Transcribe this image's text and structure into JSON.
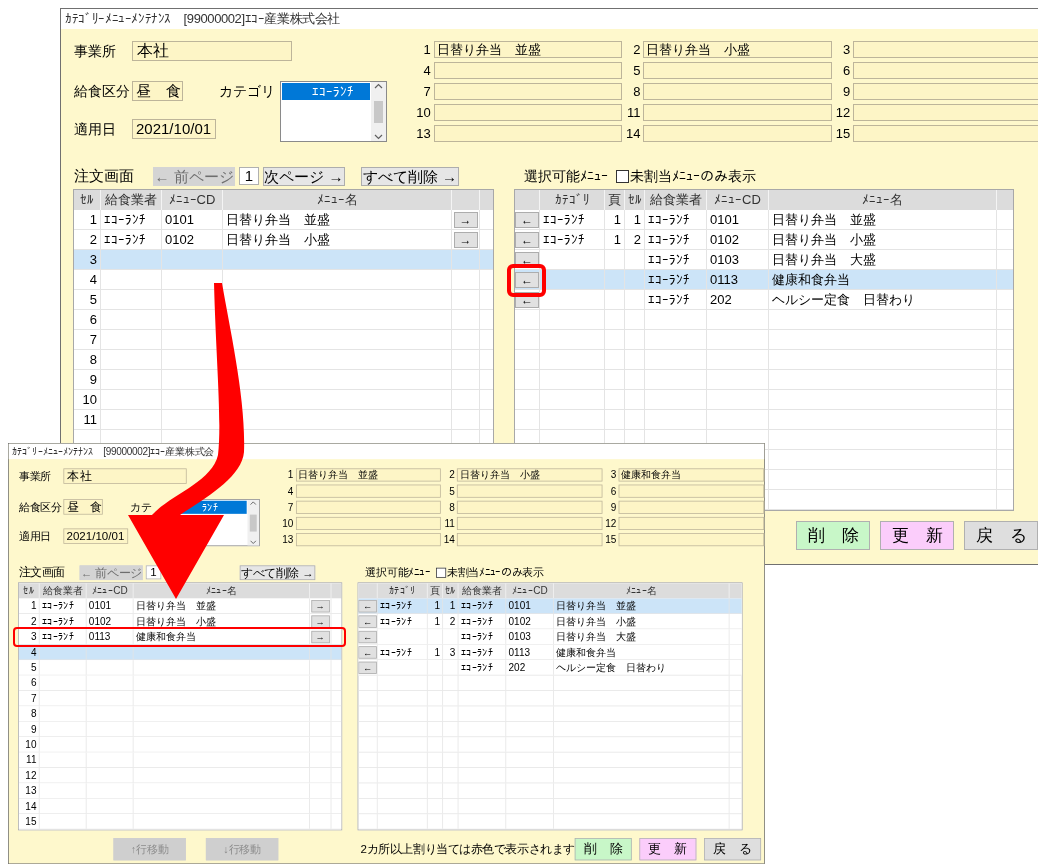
{
  "windows": [
    {
      "title": "ｶﾃｺﾞﾘｰﾒﾆｭｰﾒﾝﾃﾅﾝｽ　[99000002]ｴｺｰ産業株式会社",
      "office": {
        "label": "事業所",
        "value": "本社"
      },
      "meal": {
        "label": "給食区分",
        "value": "昼　食"
      },
      "date": {
        "label": "適用日",
        "value": "2021/10/01"
      },
      "category": {
        "label": "カテゴリ",
        "items": [
          {
            "label": "ｴｺｰﾗﾝﾁ",
            "selected": true
          }
        ]
      },
      "slots": [
        {
          "no": "1",
          "value": "日替り弁当　並盛"
        },
        {
          "no": "2",
          "value": "日替り弁当　小盛"
        },
        {
          "no": "3"
        },
        {
          "no": "4"
        },
        {
          "no": "5"
        },
        {
          "no": "6"
        },
        {
          "no": "7"
        },
        {
          "no": "8"
        },
        {
          "no": "9"
        },
        {
          "no": "10"
        },
        {
          "no": "11"
        },
        {
          "no": "12"
        },
        {
          "no": "13"
        },
        {
          "no": "14"
        },
        {
          "no": "15"
        }
      ],
      "order": {
        "title": "注文画面",
        "prev": {
          "label": "← 前ページ",
          "disabled": true
        },
        "page": "1",
        "next": {
          "label": "次ページ →",
          "disabled": false
        },
        "clear": {
          "label": "すべて削除 →"
        },
        "columns": [
          "ｾﾙ",
          "給食業者",
          "ﾒﾆｭｰCD",
          "ﾒﾆｭｰ名"
        ],
        "rows": [
          {
            "cell": "1",
            "vendor": "ｴｺｰﾗﾝﾁ",
            "code": "0101",
            "name": "日替り弁当　並盛",
            "action": "→",
            "selected": false
          },
          {
            "cell": "2",
            "vendor": "ｴｺｰﾗﾝﾁ",
            "code": "0102",
            "name": "日替り弁当　小盛",
            "action": "→",
            "selected": false
          },
          {
            "cell": "3",
            "selected": true
          },
          {
            "cell": "4",
            "selected": false
          },
          {
            "cell": "5",
            "selected": false
          },
          {
            "cell": "6",
            "selected": false
          },
          {
            "cell": "7",
            "selected": false
          },
          {
            "cell": "8",
            "selected": false
          },
          {
            "cell": "9",
            "selected": false
          },
          {
            "cell": "10",
            "selected": false
          },
          {
            "cell": "11",
            "selected": false
          }
        ]
      },
      "available": {
        "title": "選択可能ﾒﾆｭｰ",
        "filter": {
          "label": "未割当ﾒﾆｭｰのみ表示",
          "checked": false
        },
        "columns": [
          "ｶﾃｺﾞﾘ",
          "頁",
          "ｾﾙ",
          "給食業者",
          "ﾒﾆｭｰCD",
          "ﾒﾆｭｰ名"
        ],
        "rows": [
          {
            "action": "←",
            "category": "ｴｺｰﾗﾝﾁ",
            "page": "1",
            "cell": "1",
            "vendor": "ｴｺｰﾗﾝﾁ",
            "code": "0101",
            "name": "日替り弁当　並盛",
            "selected": false
          },
          {
            "action": "←",
            "category": "ｴｺｰﾗﾝﾁ",
            "page": "1",
            "cell": "2",
            "vendor": "ｴｺｰﾗﾝﾁ",
            "code": "0102",
            "name": "日替り弁当　小盛",
            "selected": false
          },
          {
            "action": "←",
            "vendor": "ｴｺｰﾗﾝﾁ",
            "code": "0103",
            "name": "日替り弁当　大盛",
            "selected": false
          },
          {
            "action": "←",
            "vendor": "ｴｺｰﾗﾝﾁ",
            "code": "0113",
            "name": "健康和食弁当",
            "selected": true
          },
          {
            "action": "←",
            "vendor": "ｴｺｰﾗﾝﾁ",
            "code": "202",
            "name": "ヘルシー定食　日替わり",
            "selected": false
          }
        ]
      },
      "buttons": [
        {
          "label": "削　除",
          "kind": "delete"
        },
        {
          "label": "更　新",
          "kind": "update"
        },
        {
          "label": "戻　る",
          "kind": "back"
        }
      ]
    },
    {
      "title": "ｶﾃｺﾞﾘｰﾒﾆｭｰﾒﾝﾃﾅﾝｽ　[99000002]ｴｺｰ産業株式会",
      "office": {
        "label": "事業所",
        "value": "本社"
      },
      "meal": {
        "label": "給食区分",
        "value": "昼　食"
      },
      "date": {
        "label": "適用日",
        "value": "2021/10/01"
      },
      "category": {
        "label": "カテ",
        "items": [
          {
            "label": "ﾗﾝﾁ",
            "selected": true
          }
        ]
      },
      "slots": [
        {
          "no": "1",
          "value": "日替り弁当　並盛"
        },
        {
          "no": "2",
          "value": "日替り弁当　小盛"
        },
        {
          "no": "3",
          "value": "健康和食弁当"
        },
        {
          "no": "4"
        },
        {
          "no": "5"
        },
        {
          "no": "6"
        },
        {
          "no": "7"
        },
        {
          "no": "8"
        },
        {
          "no": "9"
        },
        {
          "no": "10"
        },
        {
          "no": "11"
        },
        {
          "no": "12"
        },
        {
          "no": "13"
        },
        {
          "no": "14"
        },
        {
          "no": "15"
        }
      ],
      "order": {
        "title": "注文画面",
        "prev": {
          "label": "← 前ページ",
          "disabled": true
        },
        "page": "1",
        "clear": {
          "label": "すべて削除 →"
        },
        "columns": [
          "ｾﾙ",
          "給食業者",
          "ﾒﾆｭｰCD",
          "ﾒﾆｭｰ名"
        ],
        "rows": [
          {
            "cell": "1",
            "vendor": "ｴｺｰﾗﾝﾁ",
            "code": "0101",
            "name": "日替り弁当　並盛",
            "action": "→",
            "selected": false
          },
          {
            "cell": "2",
            "vendor": "ｴｺｰﾗﾝﾁ",
            "code": "0102",
            "name": "日替り弁当　小盛",
            "action": "→",
            "selected": false
          },
          {
            "cell": "3",
            "vendor": "ｴｺｰﾗﾝﾁ",
            "code": "0113",
            "name": "健康和食弁当",
            "action": "→",
            "selected": false
          },
          {
            "cell": "4",
            "selected": true
          },
          {
            "cell": "5",
            "selected": false
          },
          {
            "cell": "6",
            "selected": false
          },
          {
            "cell": "7",
            "selected": false
          },
          {
            "cell": "8",
            "selected": false
          },
          {
            "cell": "9",
            "selected": false
          },
          {
            "cell": "10",
            "selected": false
          },
          {
            "cell": "11",
            "selected": false
          },
          {
            "cell": "12",
            "selected": false
          },
          {
            "cell": "13",
            "selected": false
          },
          {
            "cell": "14",
            "selected": false
          },
          {
            "cell": "15",
            "selected": false
          }
        ]
      },
      "available": {
        "title": "選択可能ﾒﾆｭｰ",
        "filter": {
          "label": "未割当ﾒﾆｭｰのみ表示",
          "checked": false
        },
        "columns": [
          "ｶﾃｺﾞﾘ",
          "頁",
          "ｾﾙ",
          "給食業者",
          "ﾒﾆｭｰCD",
          "ﾒﾆｭｰ名"
        ],
        "rows": [
          {
            "action": "←",
            "category": "ｴｺｰﾗﾝﾁ",
            "page": "1",
            "cell": "1",
            "vendor": "ｴｺｰﾗﾝﾁ",
            "code": "0101",
            "name": "日替り弁当　並盛",
            "selected": true
          },
          {
            "action": "←",
            "category": "ｴｺｰﾗﾝﾁ",
            "page": "1",
            "cell": "2",
            "vendor": "ｴｺｰﾗﾝﾁ",
            "code": "0102",
            "name": "日替り弁当　小盛",
            "selected": false
          },
          {
            "action": "←",
            "vendor": "ｴｺｰﾗﾝﾁ",
            "code": "0103",
            "name": "日替り弁当　大盛",
            "selected": false
          },
          {
            "action": "←",
            "category": "ｴｺｰﾗﾝﾁ",
            "page": "1",
            "cell": "3",
            "vendor": "ｴｺｰﾗﾝﾁ",
            "code": "0113",
            "name": "健康和食弁当",
            "selected": false
          },
          {
            "action": "←",
            "vendor": "ｴｺｰﾗﾝﾁ",
            "code": "202",
            "name": "ヘルシー定食　日替わり",
            "selected": false
          }
        ]
      },
      "move_buttons": [
        {
          "label": "↑行移動",
          "disabled": true
        },
        {
          "label": "↓行移動",
          "disabled": true
        }
      ],
      "note": "2カ所以上割り当ては赤色で表示されます",
      "buttons": [
        {
          "label": "削　除",
          "kind": "delete"
        },
        {
          "label": "更　新",
          "kind": "update"
        },
        {
          "label": "戻　る",
          "kind": "back"
        }
      ]
    }
  ]
}
